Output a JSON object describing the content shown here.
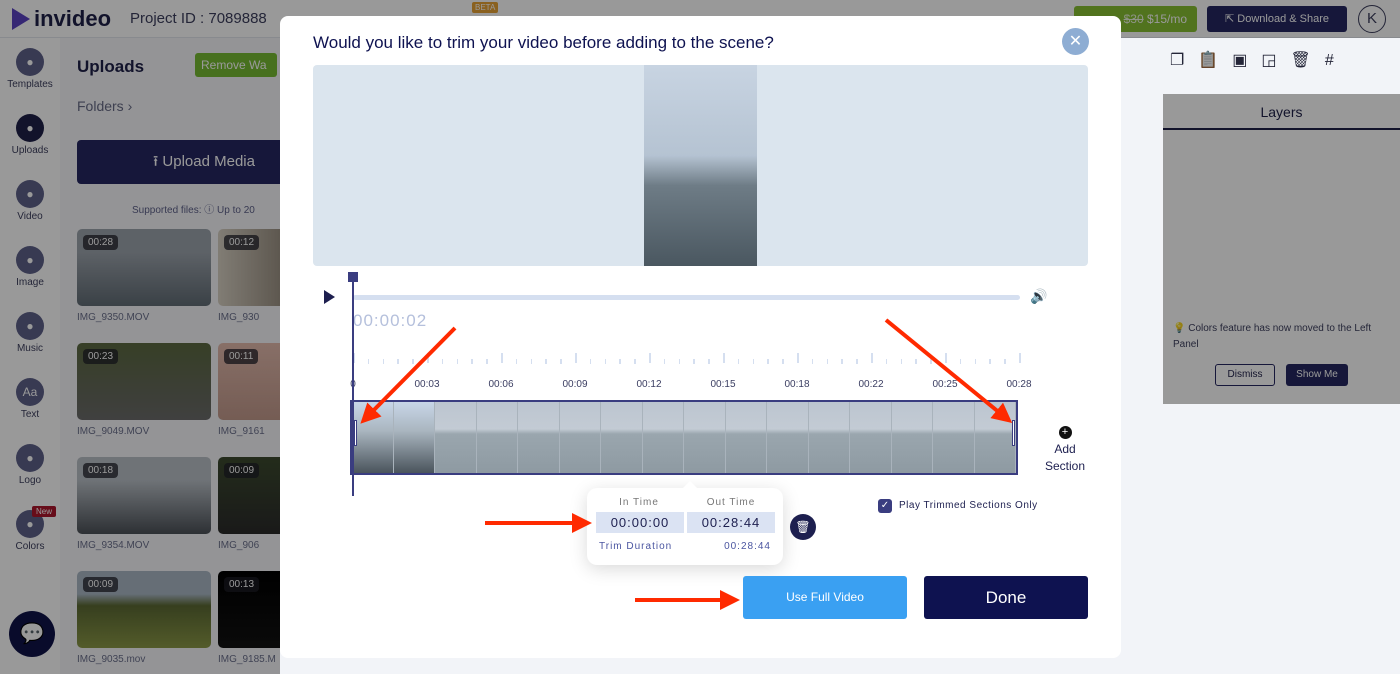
{
  "topbar": {
    "brand": "invideo",
    "project": "Project ID : 7089888",
    "beta": "BETA",
    "upgrade_old": "$30",
    "upgrade_new": "$15/mo",
    "download": "Download & Share",
    "avatar": "K"
  },
  "sidebar": {
    "items": [
      {
        "label": "Templates",
        "icon": "template-icon"
      },
      {
        "label": "Uploads",
        "icon": "upload-icon"
      },
      {
        "label": "Video",
        "icon": "video-icon"
      },
      {
        "label": "Image",
        "icon": "image-icon"
      },
      {
        "label": "Music",
        "icon": "music-icon"
      },
      {
        "label": "Text",
        "icon": "text-icon",
        "glyph": "Aa"
      },
      {
        "label": "Logo",
        "icon": "logo-icon"
      },
      {
        "label": "Colors",
        "icon": "palette-icon",
        "badge": "New"
      }
    ]
  },
  "panel": {
    "title": "Uploads",
    "remove_watermark": "Remove Wa",
    "folders": "Folders ›",
    "upload_button": "Upload Media",
    "supported": "Supported files:  ⓘ  Up to 20",
    "media": [
      {
        "duration": "00:28",
        "name": "IMG_9350.MOV"
      },
      {
        "duration": "00:12",
        "name": "IMG_930"
      },
      {
        "duration": "00:23",
        "name": "IMG_9049.MOV"
      },
      {
        "duration": "00:11",
        "name": "IMG_9161"
      },
      {
        "duration": "00:18",
        "name": "IMG_9354.MOV"
      },
      {
        "duration": "00:09",
        "name": "IMG_906"
      },
      {
        "duration": "00:09",
        "name": "IMG_9035.mov"
      },
      {
        "duration": "00:13",
        "name": "IMG_9185.M"
      }
    ]
  },
  "layers": {
    "title": "Layers",
    "tip": "Colors feature has now moved to the Left Panel",
    "dismiss": "Dismiss",
    "show_me": "Show Me"
  },
  "modal": {
    "title": "Would you like to trim your video before adding to the scene?",
    "current_time": "00:00:02",
    "ticks": [
      "0",
      "00:03",
      "00:06",
      "00:09",
      "00:12",
      "00:15",
      "00:18",
      "00:22",
      "00:25",
      "00:28"
    ],
    "add_section": "Add Section",
    "in_time_label": "In Time",
    "out_time_label": "Out Time",
    "in_time": "00:00:00",
    "out_time": "00:28:44",
    "trim_duration_label": "Trim Duration",
    "trim_duration": "00:28:44",
    "play_trimmed_label": "Play Trimmed Sections Only",
    "play_trimmed_checked": true,
    "use_full_video": "Use Full Video",
    "done": "Done",
    "accent": "#3aa0f2",
    "done_color": "#0e1250"
  },
  "annotation_color": "#ff2a00"
}
